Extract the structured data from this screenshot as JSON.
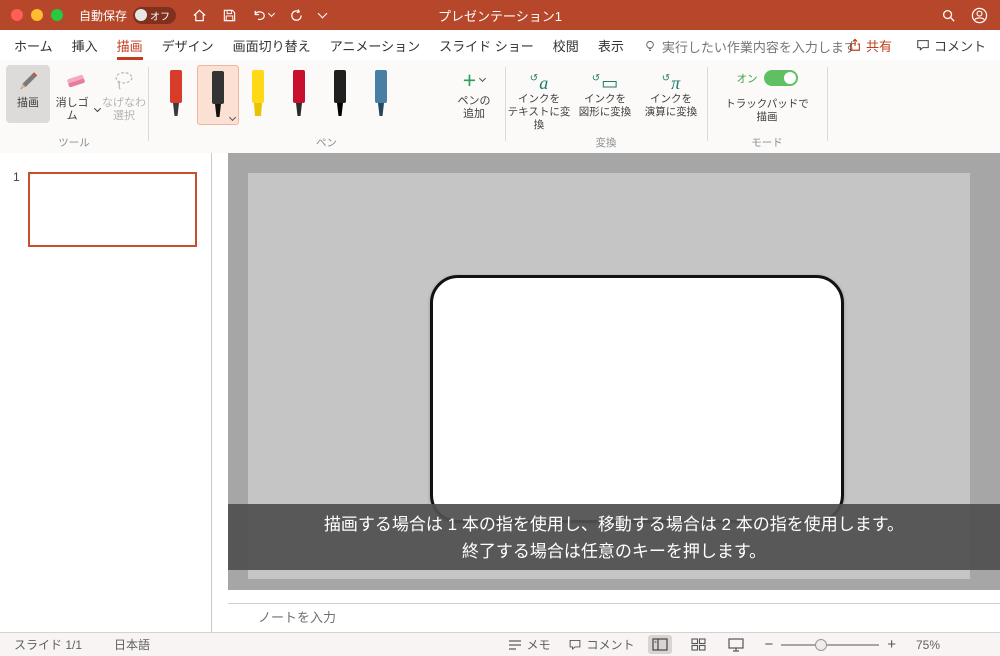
{
  "colors": {
    "titlebar": "#b7472a",
    "accent_red": "#c33c1d",
    "toggle_green": "#5ec062",
    "pen_selected_bg": "#fbe1d4",
    "slide_thumb_border": "#c4512e",
    "canvas_gray": "#a6a6a6",
    "slide_gray": "#c5c5c5",
    "toast_gray": "#505050",
    "convert_icon_teal": "#1f7a68"
  },
  "window": {
    "autosave_label": "自動保存",
    "autosave_state": "オフ",
    "title": "プレゼンテーション1"
  },
  "tabs": {
    "items": [
      {
        "label": "ホーム"
      },
      {
        "label": "挿入"
      },
      {
        "label": "描画",
        "active": true
      },
      {
        "label": "デザイン"
      },
      {
        "label": "画面切り替え"
      },
      {
        "label": "アニメーション"
      },
      {
        "label": "スライド ショー"
      },
      {
        "label": "校閲"
      },
      {
        "label": "表示"
      }
    ],
    "tell_me": "実行したい作業内容を入力します",
    "share_label": "共有",
    "comments_label": "コメント"
  },
  "ribbon": {
    "tools": {
      "group_label": "ツール",
      "draw_label": "描画",
      "eraser_label": "消しゴム",
      "lasso_label": "なげなわ\n選択"
    },
    "pens": {
      "group_label": "ペン",
      "add_pen_label": "ペンの\n追加",
      "add_pen_plus": "+",
      "items": [
        {
          "name": "red-pen",
          "body": "#d83b2a",
          "tip": "#3a3a3a"
        },
        {
          "name": "black-pen",
          "body": "#333333",
          "tip": "#111111",
          "selected": true
        },
        {
          "name": "yellow-highlighter",
          "body": "#ffd916",
          "tip": "#e8c304"
        },
        {
          "name": "red-marker",
          "body": "#c8102e",
          "tip": "#2b2b2b"
        },
        {
          "name": "black-marker",
          "body": "#1f1f1f",
          "tip": "#000000"
        },
        {
          "name": "galaxy-pen",
          "body": "#4a7fa5",
          "tip": "#24465e"
        }
      ]
    },
    "convert": {
      "group_label": "変換",
      "items": [
        {
          "icon": "a",
          "arrow": "↺",
          "label": "インクを\nテキストに変換"
        },
        {
          "icon": "▭",
          "arrow": "↺",
          "label": "インクを\n図形に変換"
        },
        {
          "icon": "π",
          "arrow": "↺",
          "label": "インクを\n演算に変換"
        }
      ]
    },
    "mode": {
      "group_label": "モード",
      "toggle_state": "オン",
      "label": "トラックパッドで\n描画"
    }
  },
  "slides_panel": {
    "slide_number": "1"
  },
  "canvas": {
    "toast_line1": "描画する場合は 1 本の指を使用し、移動する場合は 2 本の指を使用します。",
    "toast_line2": "終了する場合は任意のキーを押します。"
  },
  "notes": {
    "placeholder": "ノートを入力"
  },
  "status_bar": {
    "slide_count": "スライド 1/1",
    "language": "日本語",
    "notes_label": "メモ",
    "comments_label": "コメント",
    "zoom_level": "75%"
  }
}
